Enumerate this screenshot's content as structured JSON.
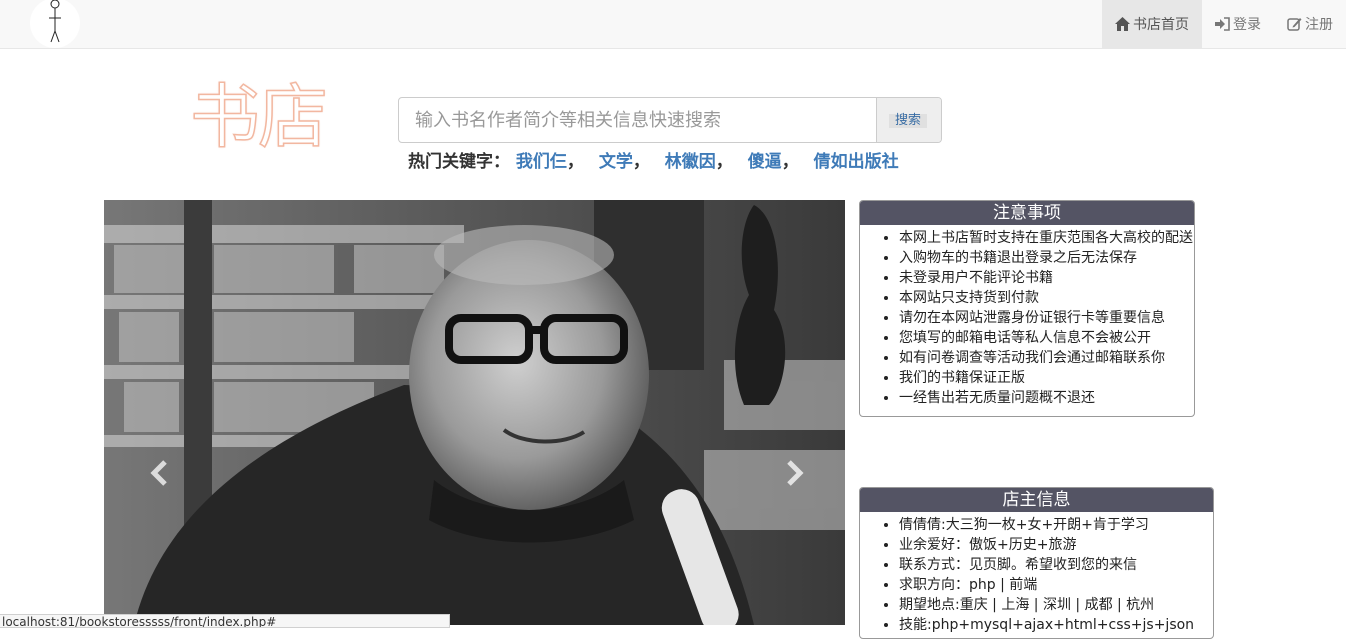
{
  "nav": {
    "items": [
      {
        "label": "书店首页",
        "icon": "home-icon"
      },
      {
        "label": "登录",
        "icon": "log-in-icon"
      },
      {
        "label": "注册",
        "icon": "edit-icon"
      }
    ]
  },
  "header": {
    "brand": "书店",
    "search_placeholder": "输入书名作者简介等相关信息快速搜索",
    "search_button": "搜索",
    "hot_label": "热门关键字：",
    "hot_keywords": [
      "我们仨",
      "文学",
      "林徽因",
      "傻逼",
      "倩如出版社"
    ],
    "hot_separator": "，"
  },
  "carousel": {
    "prev_icon": "chevron-left-icon",
    "next_icon": "chevron-right-icon"
  },
  "notice": {
    "title": "注意事项",
    "items": [
      "本网上书店暂时支持在重庆范围各大高校的配送",
      "入购物车的书籍退出登录之后无法保存",
      "未登录用户不能评论书籍",
      "本网站只支持货到付款",
      "请勿在本网站泄露身份证银行卡等重要信息",
      "您填写的邮箱电话等私人信息不会被公开",
      "如有问卷调查等活动我们会通过邮箱联系你",
      "我们的书籍保证正版",
      "一经售出若无质量问题概不退还"
    ]
  },
  "owner": {
    "title": "店主信息",
    "items": [
      "倩倩倩:大三狗一枚+女+开朗+肯于学习",
      "业余爱好：傲饭+历史+旅游",
      "联系方式：见页脚。希望收到您的来信",
      "求职方向：php | 前端",
      "期望地点:重庆 | 上海 | 深圳 | 成都 | 杭州",
      "技能:php+mysql+ajax+html+css+js+json"
    ]
  },
  "status_url": "localhost:81/bookstoresssss/front/index.php#",
  "colors": {
    "panel_header": "#545464",
    "link": "#3f7bb8",
    "brand_outline": "#f2b7a0",
    "navbar_bg": "#f8f8f8"
  }
}
